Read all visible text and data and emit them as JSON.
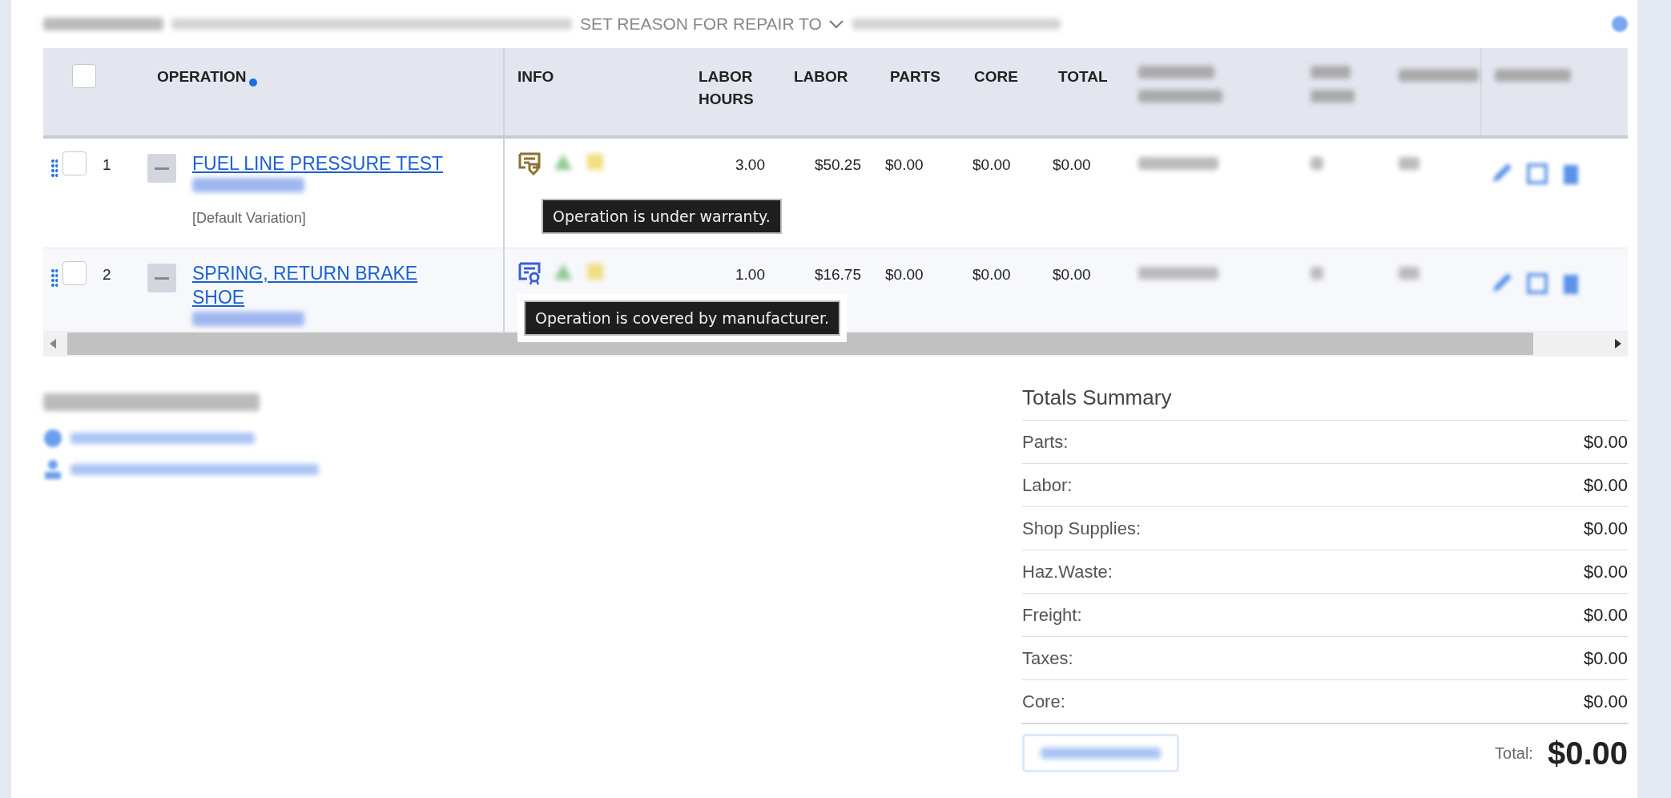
{
  "toolbar": {
    "actions": [
      {
        "label": "SET REASON FOR REPAIR TO",
        "kind": "dropdown"
      }
    ]
  },
  "table": {
    "select_all": {
      "checked": false
    },
    "columns": [
      {
        "label": "OPERATION",
        "sorted": true
      },
      {
        "label": "INFO",
        "sorted": false
      },
      {
        "label": "LABOR HOURS",
        "sorted": false
      },
      {
        "label": "LABOR",
        "sorted": false
      },
      {
        "label": "PARTS",
        "sorted": false
      },
      {
        "label": "CORE",
        "sorted": false
      },
      {
        "label": "TOTAL",
        "sorted": false
      }
    ],
    "rows": [
      {
        "number": "1",
        "checked": false,
        "operation": "FUEL LINE PRESSURE TEST",
        "variation": "[Default Variation]",
        "kind": "warranty",
        "tooltip": "Operation is under warranty.",
        "labor_hours": "3.00",
        "labor": "$50.25",
        "parts": "$0.00",
        "core": "$0.00",
        "total": "$0.00"
      },
      {
        "number": "2",
        "checked": false,
        "operation": "SPRING, RETURN BRAKE SHOE",
        "kind": "manufacturer",
        "tooltip": "Operation is covered by manufacturer.",
        "labor_hours": "1.00",
        "labor": "$16.75",
        "parts": "$0.00",
        "core": "$0.00",
        "total": "$0.00"
      }
    ]
  },
  "totals_summary": {
    "title": "Totals Summary",
    "rows": [
      {
        "label": "Parts:",
        "value": "$0.00"
      },
      {
        "label": "Labor:",
        "value": "$0.00"
      },
      {
        "label": "Shop Supplies:",
        "value": "$0.00"
      },
      {
        "label": "Haz.Waste:",
        "value": "$0.00"
      },
      {
        "label": "Freight:",
        "value": "$0.00"
      },
      {
        "label": "Taxes:",
        "value": "$0.00"
      },
      {
        "label": "Core:",
        "value": "$0.00"
      }
    ],
    "total_label": "Total:",
    "total": "$0.00"
  }
}
